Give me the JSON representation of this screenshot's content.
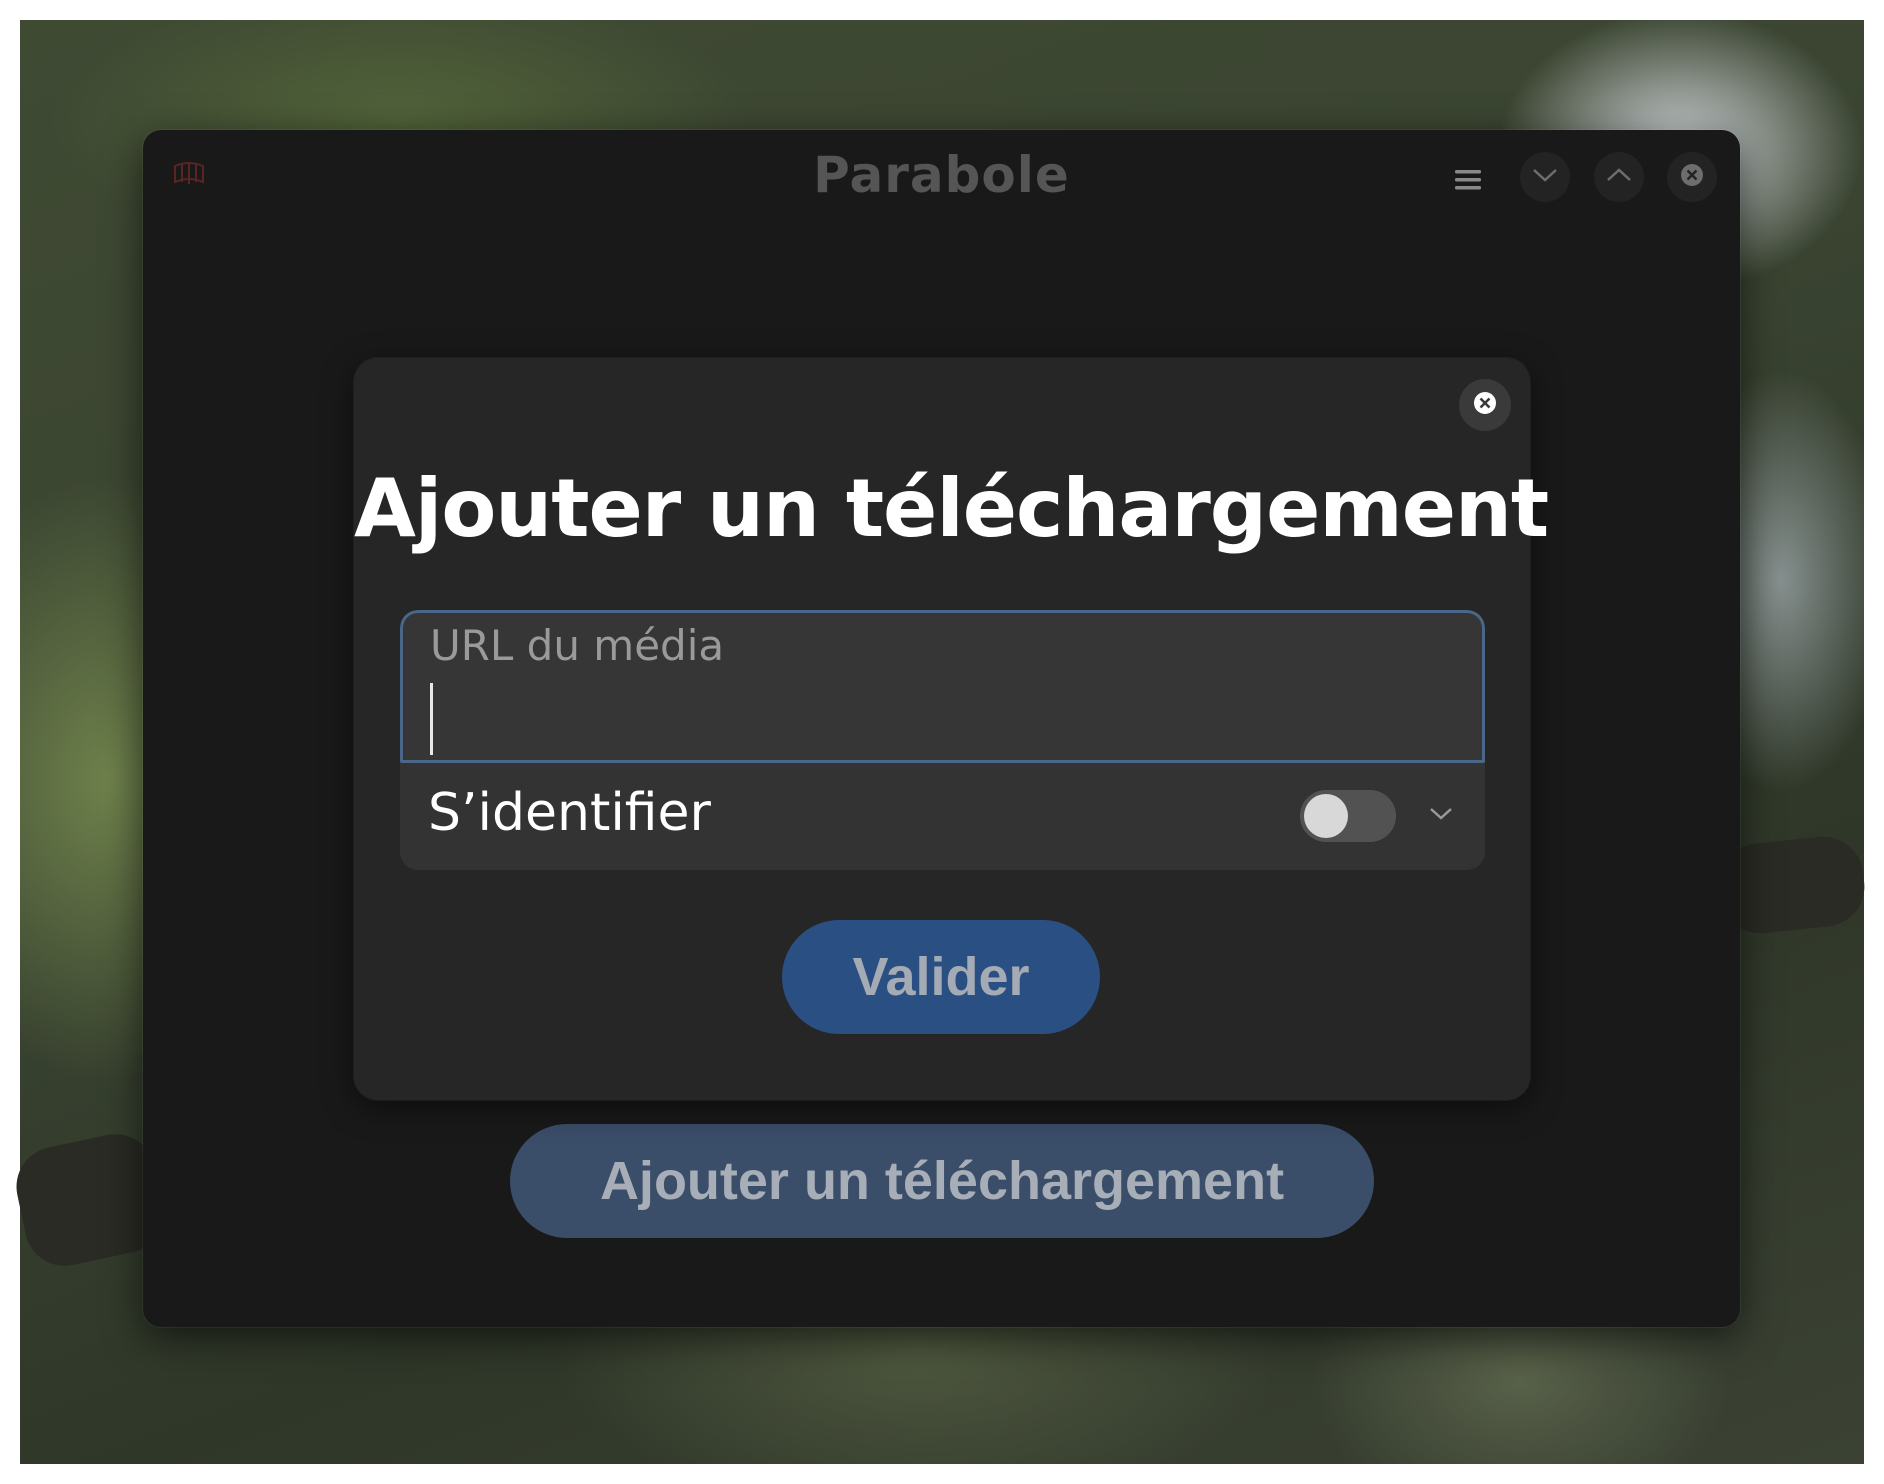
{
  "window": {
    "title": "Parabole",
    "app_icon": "parabole-app-icon",
    "controls": [
      "menu-icon",
      "minimize-icon",
      "maximize-icon",
      "close-icon"
    ]
  },
  "backdrop": {
    "add_download_label": "Ajouter un téléchargement"
  },
  "dialog": {
    "title": "Ajouter un téléchargement",
    "close_icon": "close-icon",
    "url_field": {
      "label": "URL du média",
      "value": ""
    },
    "auth_row": {
      "label": "S’identifier",
      "switch_on": false
    },
    "validate_label": "Valider"
  },
  "colors": {
    "accent": "#2a5083",
    "window_bg": "#191919",
    "dialog_bg": "#262626",
    "focus_ring": "#4a6689"
  }
}
